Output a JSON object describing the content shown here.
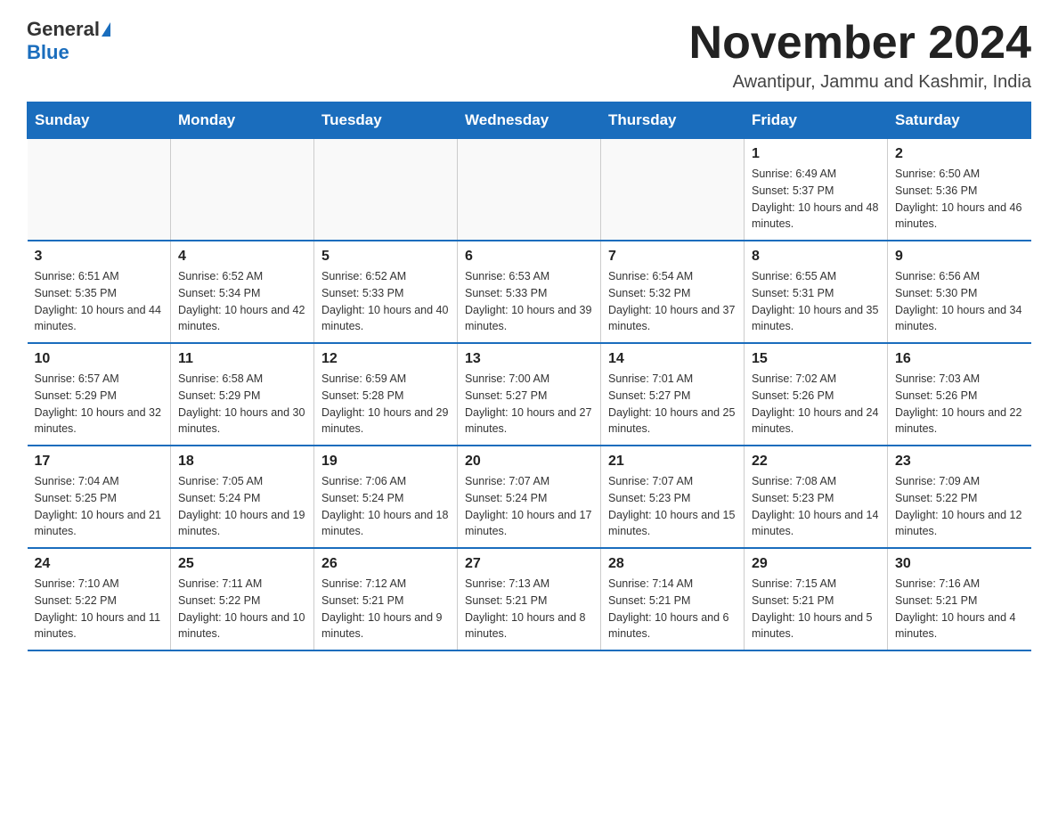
{
  "logo": {
    "text_general": "General",
    "text_blue": "Blue"
  },
  "header": {
    "month": "November 2024",
    "location": "Awantipur, Jammu and Kashmir, India"
  },
  "weekdays": [
    "Sunday",
    "Monday",
    "Tuesday",
    "Wednesday",
    "Thursday",
    "Friday",
    "Saturday"
  ],
  "weeks": [
    [
      {
        "day": "",
        "info": ""
      },
      {
        "day": "",
        "info": ""
      },
      {
        "day": "",
        "info": ""
      },
      {
        "day": "",
        "info": ""
      },
      {
        "day": "",
        "info": ""
      },
      {
        "day": "1",
        "info": "Sunrise: 6:49 AM\nSunset: 5:37 PM\nDaylight: 10 hours and 48 minutes."
      },
      {
        "day": "2",
        "info": "Sunrise: 6:50 AM\nSunset: 5:36 PM\nDaylight: 10 hours and 46 minutes."
      }
    ],
    [
      {
        "day": "3",
        "info": "Sunrise: 6:51 AM\nSunset: 5:35 PM\nDaylight: 10 hours and 44 minutes."
      },
      {
        "day": "4",
        "info": "Sunrise: 6:52 AM\nSunset: 5:34 PM\nDaylight: 10 hours and 42 minutes."
      },
      {
        "day": "5",
        "info": "Sunrise: 6:52 AM\nSunset: 5:33 PM\nDaylight: 10 hours and 40 minutes."
      },
      {
        "day": "6",
        "info": "Sunrise: 6:53 AM\nSunset: 5:33 PM\nDaylight: 10 hours and 39 minutes."
      },
      {
        "day": "7",
        "info": "Sunrise: 6:54 AM\nSunset: 5:32 PM\nDaylight: 10 hours and 37 minutes."
      },
      {
        "day": "8",
        "info": "Sunrise: 6:55 AM\nSunset: 5:31 PM\nDaylight: 10 hours and 35 minutes."
      },
      {
        "day": "9",
        "info": "Sunrise: 6:56 AM\nSunset: 5:30 PM\nDaylight: 10 hours and 34 minutes."
      }
    ],
    [
      {
        "day": "10",
        "info": "Sunrise: 6:57 AM\nSunset: 5:29 PM\nDaylight: 10 hours and 32 minutes."
      },
      {
        "day": "11",
        "info": "Sunrise: 6:58 AM\nSunset: 5:29 PM\nDaylight: 10 hours and 30 minutes."
      },
      {
        "day": "12",
        "info": "Sunrise: 6:59 AM\nSunset: 5:28 PM\nDaylight: 10 hours and 29 minutes."
      },
      {
        "day": "13",
        "info": "Sunrise: 7:00 AM\nSunset: 5:27 PM\nDaylight: 10 hours and 27 minutes."
      },
      {
        "day": "14",
        "info": "Sunrise: 7:01 AM\nSunset: 5:27 PM\nDaylight: 10 hours and 25 minutes."
      },
      {
        "day": "15",
        "info": "Sunrise: 7:02 AM\nSunset: 5:26 PM\nDaylight: 10 hours and 24 minutes."
      },
      {
        "day": "16",
        "info": "Sunrise: 7:03 AM\nSunset: 5:26 PM\nDaylight: 10 hours and 22 minutes."
      }
    ],
    [
      {
        "day": "17",
        "info": "Sunrise: 7:04 AM\nSunset: 5:25 PM\nDaylight: 10 hours and 21 minutes."
      },
      {
        "day": "18",
        "info": "Sunrise: 7:05 AM\nSunset: 5:24 PM\nDaylight: 10 hours and 19 minutes."
      },
      {
        "day": "19",
        "info": "Sunrise: 7:06 AM\nSunset: 5:24 PM\nDaylight: 10 hours and 18 minutes."
      },
      {
        "day": "20",
        "info": "Sunrise: 7:07 AM\nSunset: 5:24 PM\nDaylight: 10 hours and 17 minutes."
      },
      {
        "day": "21",
        "info": "Sunrise: 7:07 AM\nSunset: 5:23 PM\nDaylight: 10 hours and 15 minutes."
      },
      {
        "day": "22",
        "info": "Sunrise: 7:08 AM\nSunset: 5:23 PM\nDaylight: 10 hours and 14 minutes."
      },
      {
        "day": "23",
        "info": "Sunrise: 7:09 AM\nSunset: 5:22 PM\nDaylight: 10 hours and 12 minutes."
      }
    ],
    [
      {
        "day": "24",
        "info": "Sunrise: 7:10 AM\nSunset: 5:22 PM\nDaylight: 10 hours and 11 minutes."
      },
      {
        "day": "25",
        "info": "Sunrise: 7:11 AM\nSunset: 5:22 PM\nDaylight: 10 hours and 10 minutes."
      },
      {
        "day": "26",
        "info": "Sunrise: 7:12 AM\nSunset: 5:21 PM\nDaylight: 10 hours and 9 minutes."
      },
      {
        "day": "27",
        "info": "Sunrise: 7:13 AM\nSunset: 5:21 PM\nDaylight: 10 hours and 8 minutes."
      },
      {
        "day": "28",
        "info": "Sunrise: 7:14 AM\nSunset: 5:21 PM\nDaylight: 10 hours and 6 minutes."
      },
      {
        "day": "29",
        "info": "Sunrise: 7:15 AM\nSunset: 5:21 PM\nDaylight: 10 hours and 5 minutes."
      },
      {
        "day": "30",
        "info": "Sunrise: 7:16 AM\nSunset: 5:21 PM\nDaylight: 10 hours and 4 minutes."
      }
    ]
  ]
}
